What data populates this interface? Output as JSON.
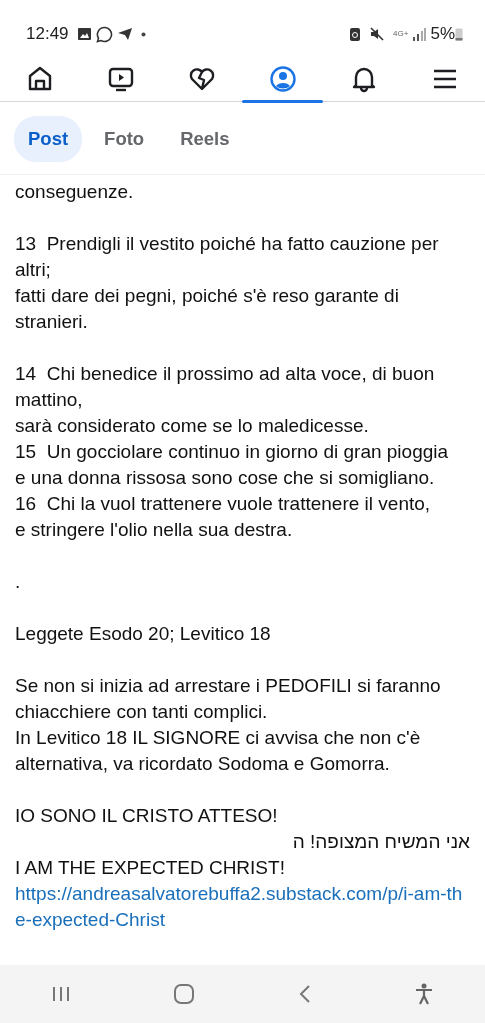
{
  "status_bar": {
    "time": "12:49",
    "network": "4G+",
    "battery": "5%"
  },
  "top_nav": [
    {
      "kind": "home",
      "selected": false
    },
    {
      "kind": "video",
      "selected": false
    },
    {
      "kind": "heart",
      "selected": false
    },
    {
      "kind": "profile",
      "selected": true
    },
    {
      "kind": "bell",
      "selected": false
    },
    {
      "kind": "menu",
      "selected": false
    }
  ],
  "tabs": [
    {
      "label": "Post",
      "selected": true
    },
    {
      "label": "Foto",
      "selected": false
    },
    {
      "label": "Reels",
      "selected": false
    }
  ],
  "post_text": [
    {
      "lines": [
        {
          "text": "conseguenze."
        }
      ]
    },
    {
      "lines": [
        {
          "text": "13  Prendigli il vestito poiché ha fatto cauzione per altri;"
        },
        {
          "text": "fatti dare dei pegni, poiché s'è reso garante di stranieri."
        }
      ]
    },
    {
      "lines": [
        {
          "text": "14  Chi benedice il prossimo ad alta voce, di buon mattino,"
        },
        {
          "text": "sarà considerato come se lo maledicesse."
        },
        {
          "text": "15  Un gocciolare continuo in giorno di gran pioggia"
        },
        {
          "text": "e una donna rissosa sono cose che si somigliano."
        },
        {
          "text": "16  Chi la vuol trattenere vuole trattenere il vento,"
        },
        {
          "text": "e stringere l'olio nella sua destra."
        }
      ]
    },
    {
      "lines": [
        {
          "text": "."
        }
      ]
    },
    {
      "lines": [
        {
          "text": "Leggete Esodo 20; Levitico 18"
        }
      ]
    },
    {
      "lines": [
        {
          "text": "Se non si inizia ad arrestare i PEDOFILI si faranno chiacchiere con tanti complici."
        },
        {
          "text": "In Levitico 18 IL SIGNORE ci avvisa che non c'è alternativa, va ricordato Sodoma e Gomorra."
        }
      ]
    },
    {
      "lines": [
        {
          "text": "IO SONO IL CRISTO ATTESO!"
        },
        {
          "text": "אני המשיח המצופה! ה",
          "kind": "rtl"
        },
        {
          "text": "I AM THE EXPECTED CHRIST!"
        },
        {
          "text": "https://andreasalvatorebuffa2.substack.com/p/i-am-the-expected-Christ",
          "kind": "link"
        }
      ]
    }
  ]
}
